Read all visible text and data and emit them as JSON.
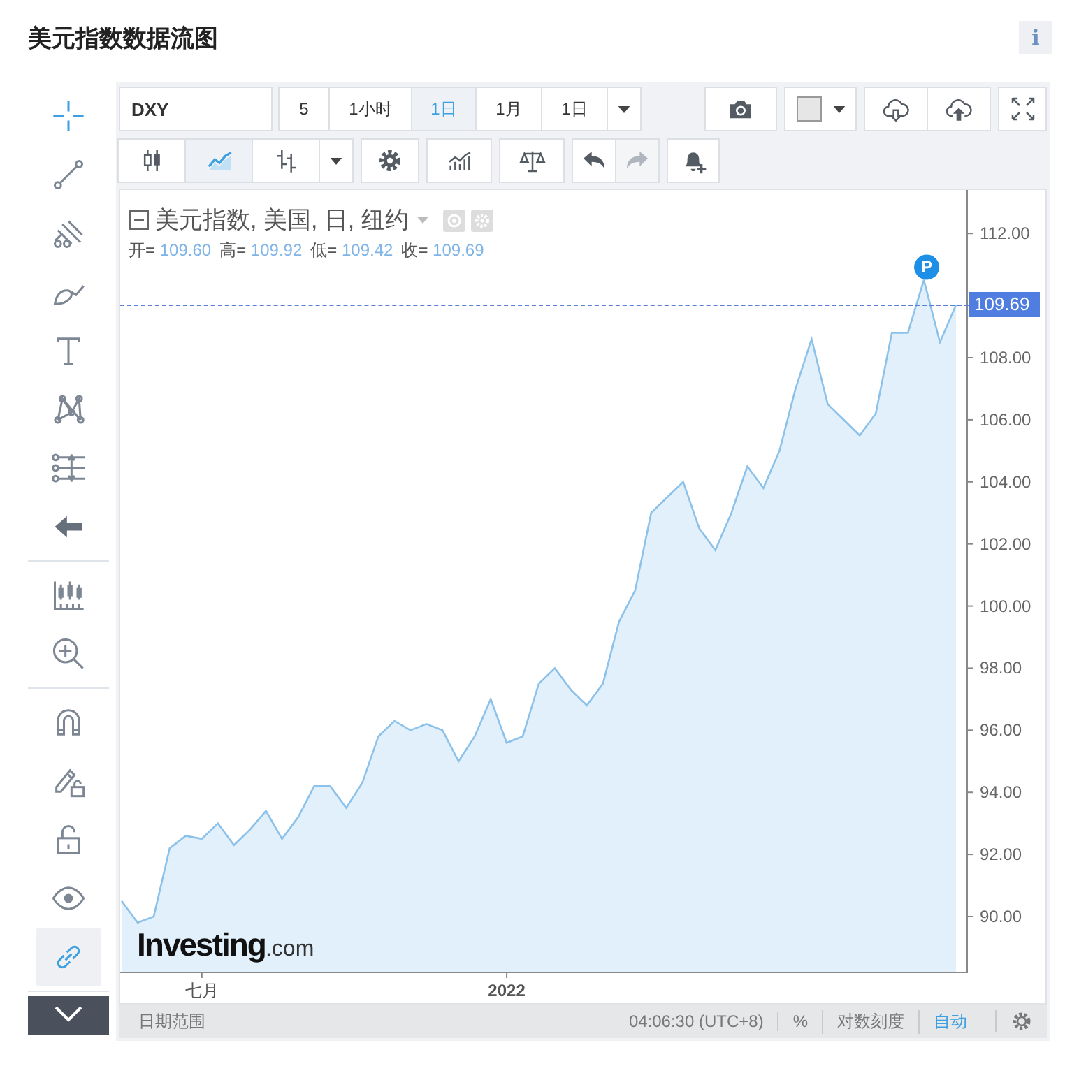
{
  "header": {
    "title": "美元指数数据流图",
    "info": "i"
  },
  "drawing_tools": {
    "groups": [
      {
        "tools": [
          {
            "kind": "crosshair",
            "selected": true
          },
          {
            "kind": "trend-line",
            "selected": false
          },
          {
            "kind": "pitchfork",
            "selected": false
          },
          {
            "kind": "brush",
            "selected": false
          },
          {
            "kind": "text",
            "selected": false
          },
          {
            "kind": "pattern",
            "selected": false
          },
          {
            "kind": "fib",
            "selected": false
          },
          {
            "kind": "back",
            "selected": false
          }
        ]
      },
      {
        "tools": [
          {
            "kind": "candle-ruler",
            "selected": false
          },
          {
            "kind": "zoom",
            "selected": false
          }
        ]
      },
      {
        "tools": [
          {
            "kind": "magnet",
            "selected": false
          },
          {
            "kind": "lock-drawings",
            "selected": false
          },
          {
            "kind": "lock",
            "selected": false
          },
          {
            "kind": "eye",
            "selected": false
          },
          {
            "kind": "link",
            "selected": true
          }
        ]
      }
    ]
  },
  "toolbar": {
    "symbol": "DXY",
    "intervals": [
      {
        "label": "5",
        "selected": false
      },
      {
        "label": "1小时",
        "selected": false
      },
      {
        "label": "1日",
        "selected": true
      },
      {
        "label": "1月",
        "selected": false
      },
      {
        "label": "1日",
        "selected": false
      }
    ],
    "chart_types": [
      {
        "kind": "candles",
        "selected": false
      },
      {
        "kind": "line",
        "selected": true
      },
      {
        "kind": "bars",
        "selected": false
      }
    ],
    "tools": [
      {
        "kind": "settings",
        "disabled": false
      },
      {
        "kind": "indicators",
        "disabled": false
      },
      {
        "kind": "compare",
        "disabled": false
      },
      {
        "kind": "undo",
        "disabled": false
      },
      {
        "kind": "redo",
        "disabled": true
      },
      {
        "kind": "alert",
        "disabled": false
      }
    ],
    "actions": [
      {
        "kind": "snapshot"
      },
      {
        "kind": "color"
      },
      {
        "kind": "download"
      },
      {
        "kind": "upload"
      },
      {
        "kind": "fullscreen"
      }
    ]
  },
  "legend": {
    "title": "美元指数, 美国, 日, 纽约",
    "ohlc": [
      {
        "label": "开=",
        "value": "109.60"
      },
      {
        "label": "高=",
        "value": "109.92"
      },
      {
        "label": "低=",
        "value": "109.42"
      },
      {
        "label": "收=",
        "value": "109.69"
      }
    ]
  },
  "price_tag": "109.69",
  "marker": "P",
  "x_axis_labels": [
    "七月",
    "2022"
  ],
  "logo": {
    "name": "Investing",
    "suffix": ".com"
  },
  "chart_data": {
    "type": "area",
    "series": [
      {
        "color": "#8cc1ea",
        "values": [
          90.5,
          89.8,
          90.0,
          92.2,
          92.6,
          92.5,
          93.0,
          92.3,
          92.8,
          93.4,
          92.5,
          93.2,
          94.2,
          94.2,
          93.5,
          94.3,
          95.8,
          96.3,
          96.0,
          96.2,
          96.0,
          95.0,
          95.8,
          97.0,
          95.6,
          95.8,
          97.5,
          98.0,
          97.3,
          96.8,
          97.5,
          99.5,
          100.5,
          103.0,
          103.5,
          104.0,
          102.5,
          101.8,
          103.0,
          104.5,
          103.8,
          105.0,
          107.0,
          108.6,
          106.5,
          106.0,
          105.5,
          106.2,
          108.8,
          108.8,
          110.5,
          108.5,
          109.7
        ]
      }
    ],
    "ylim": [
      88.2,
      113.4
    ],
    "yticks": [
      {
        "value": 90,
        "label": "90.00"
      },
      {
        "value": 92,
        "label": "92.00"
      },
      {
        "value": 94,
        "label": "94.00"
      },
      {
        "value": 96,
        "label": "96.00"
      },
      {
        "value": 98,
        "label": "98.00"
      },
      {
        "value": 100,
        "label": "100.00"
      },
      {
        "value": 102,
        "label": "102.00"
      },
      {
        "value": 104,
        "label": "104.00"
      },
      {
        "value": 106,
        "label": "106.00"
      },
      {
        "value": 108,
        "label": "108.00"
      },
      {
        "value": 112,
        "label": "112.00"
      }
    ]
  },
  "status_bar": {
    "range": "日期范围",
    "time": "04:06:30 (UTC+8)",
    "options": [
      {
        "label": "%",
        "selected": false
      },
      {
        "label": "对数刻度",
        "selected": false
      },
      {
        "label": "自动",
        "selected": true
      }
    ]
  }
}
